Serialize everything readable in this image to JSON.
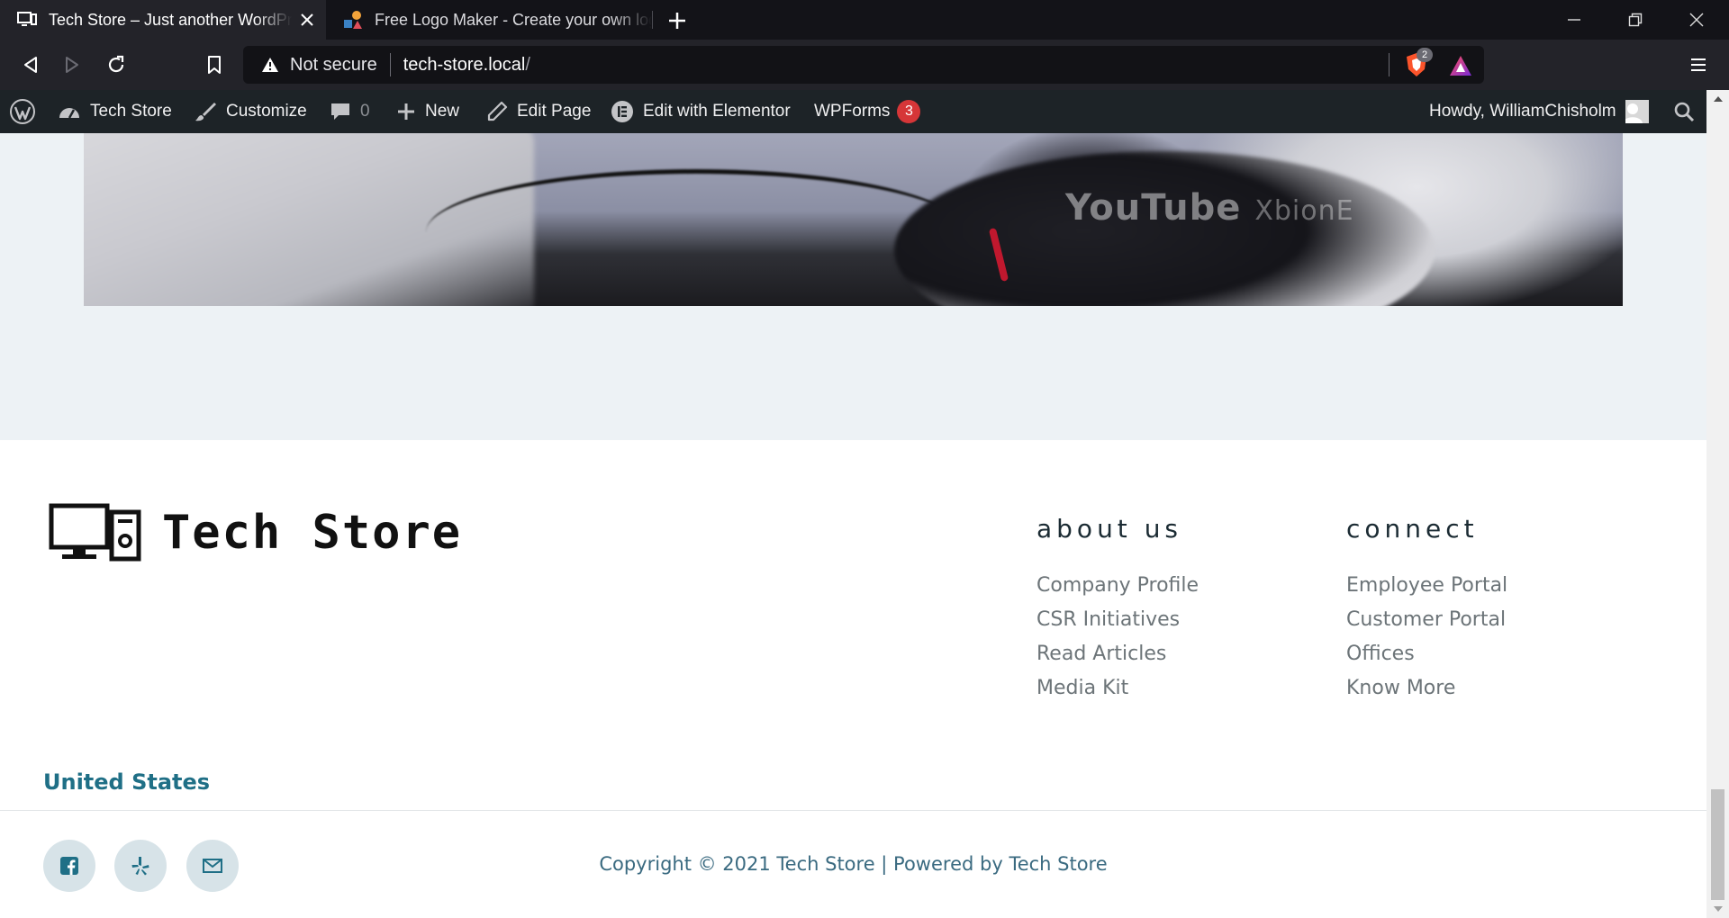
{
  "browser": {
    "tabs": [
      {
        "title": "Tech Store – Just another WordPress site",
        "favicon": "monitor-icon",
        "active": true
      },
      {
        "title": "Free Logo Maker - Create your own logo",
        "favicon": "shapes-icon",
        "active": false
      }
    ],
    "address": {
      "security": "Not secure",
      "host": "tech-store.local",
      "path": "/"
    },
    "shield_count": "2"
  },
  "adminbar": {
    "site_name": "Tech Store",
    "customize": "Customize",
    "comments_count": "0",
    "new_label": "New",
    "edit_page": "Edit Page",
    "edit_elementor": "Edit with Elementor",
    "wpforms": "WPForms",
    "wpforms_count": "3",
    "howdy": "Howdy, WilliamChisholm"
  },
  "video": {
    "watermark": "YouTube",
    "watermark_suffix": "XbionE"
  },
  "footer": {
    "logo_text": "Tech Store",
    "country": "United States",
    "social": [
      "facebook-icon",
      "yelp-icon",
      "email-icon"
    ],
    "columns": [
      {
        "title": "about us",
        "links": [
          "Company Profile",
          "CSR Initiatives",
          "Read Articles",
          "Media Kit"
        ]
      },
      {
        "title": "connect",
        "links": [
          "Employee Portal",
          "Customer Portal",
          "Offices",
          "Know More"
        ]
      }
    ],
    "copyright": "Copyright © 2021 Tech Store | Powered by Tech Store"
  },
  "colors": {
    "accent": "#1f6f86",
    "adminbar": "#1d2327",
    "hero_band": "#edf2f5"
  }
}
